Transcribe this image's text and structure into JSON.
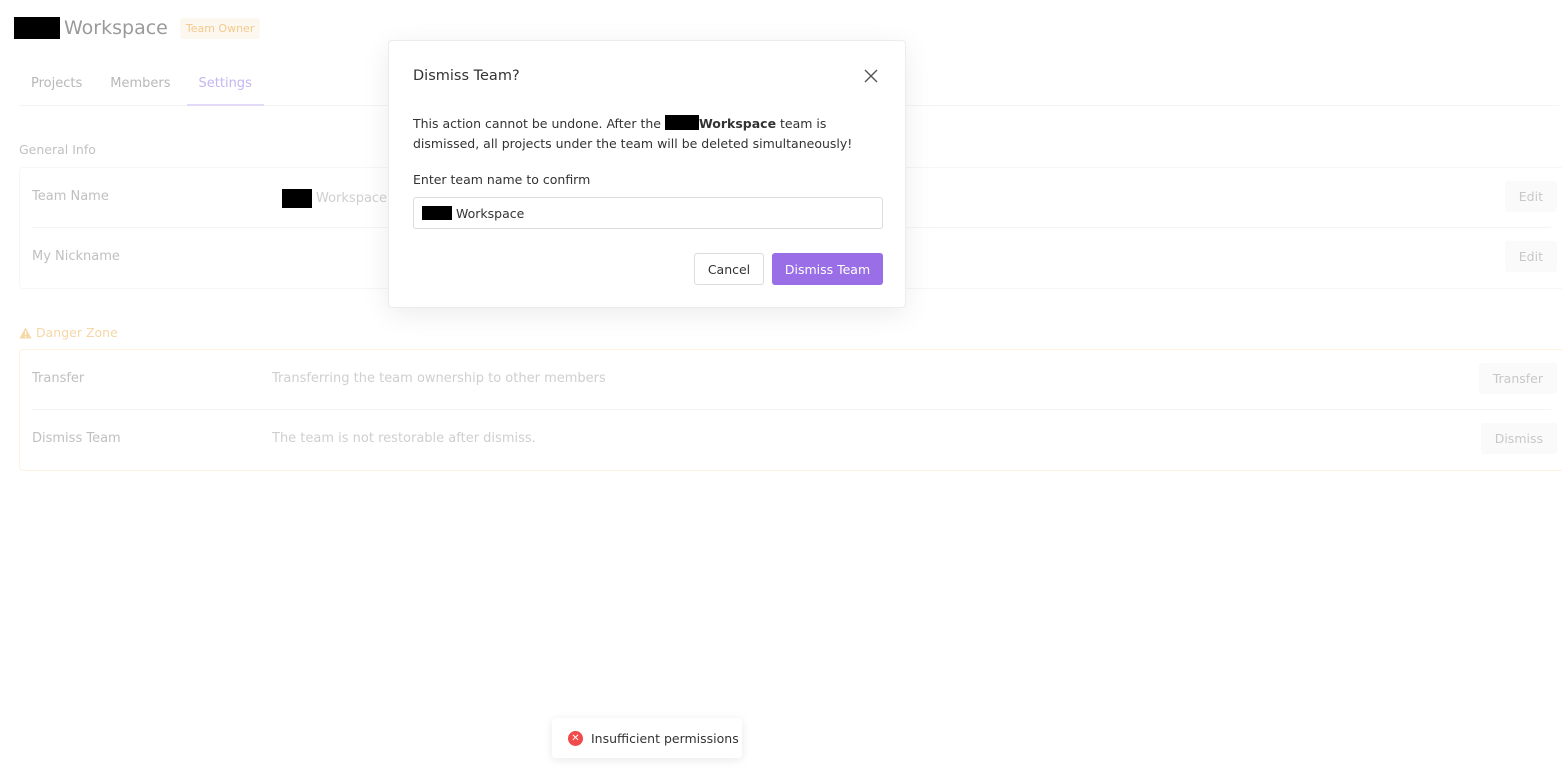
{
  "header": {
    "team_name": "Workspace",
    "role_badge": "Team Owner"
  },
  "tabs": [
    {
      "label": "Projects"
    },
    {
      "label": "Members"
    },
    {
      "label": "Settings"
    }
  ],
  "general_info": {
    "title": "General Info",
    "rows": [
      {
        "label": "Team Name",
        "value": "Workspace",
        "action": "Edit"
      },
      {
        "label": "My Nickname",
        "value": "",
        "action": "Edit"
      }
    ]
  },
  "danger_zone": {
    "title": "Danger Zone",
    "rows": [
      {
        "label": "Transfer",
        "description": "Transferring the team ownership to other members",
        "action": "Transfer"
      },
      {
        "label": "Dismiss Team",
        "description": "The team is not restorable after dismiss.",
        "action": "Dismiss"
      }
    ]
  },
  "modal": {
    "title": "Dismiss Team?",
    "body_prefix": "This action cannot be undone. After the ",
    "body_team": "Workspace",
    "body_suffix": " team is dismissed, all projects under the team will be deleted simultaneously!",
    "confirm_label": "Enter team name to confirm",
    "input_value": "Workspace",
    "cancel_label": "Cancel",
    "confirm_button": "Dismiss Team"
  },
  "toast": {
    "message": "Insufficient permissions",
    "icon": "error-icon"
  },
  "colors": {
    "primary": "#9a6ee6",
    "error": "#f04a4a",
    "warning": "#f6d7a7"
  }
}
